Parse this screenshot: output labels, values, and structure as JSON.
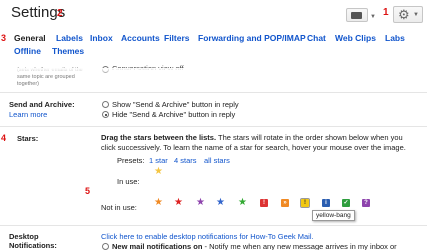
{
  "header": {
    "title": "Settings"
  },
  "annotations": {
    "n1": "1",
    "n2": "2",
    "n3": "3",
    "n4": "4",
    "n5": "5"
  },
  "tabs": [
    "General",
    "Labels",
    "Inbox",
    "Accounts",
    "Filters",
    "Forwarding and POP/IMAP",
    "Chat",
    "Web Clips",
    "Labs",
    "Offline",
    "Themes"
  ],
  "conversation": {
    "hint": "(sets whether emails of the same topic are grouped together)",
    "option_off": "Conversation view off"
  },
  "send_archive": {
    "label": "Send and Archive:",
    "learn_more": "Learn more",
    "option_show": "Show \"Send & Archive\" button in reply",
    "option_hide": "Hide \"Send & Archive\" button in reply"
  },
  "stars": {
    "label": "Stars:",
    "instr_bold": "Drag the stars between the lists.",
    "instr_rest_1": " The stars will rotate in the order shown below when you",
    "instr_line_2": "click successively. To learn the name of a star for search, hover your mouse over the image.",
    "presets_label": "Presets:",
    "preset_1": "1 star",
    "preset_4": "4 stars",
    "preset_all": "all stars",
    "in_use_label": "In use:",
    "not_in_use_label": "Not in use:",
    "tooltip": "yellow-bang",
    "colors": {
      "yellow": "#f4c542",
      "red": "#dd2222",
      "orange": "#f08a24",
      "purple": "#8e44ad",
      "blue": "#3366cc",
      "green": "#33aa33",
      "red_bang": "#dd3333",
      "orange_guillemet": "#f08a24",
      "yellow_bang": "#f2c811",
      "blue_info": "#2a5db0",
      "green_check": "#2e9e3e",
      "purple_question": "#8e44ad"
    }
  },
  "desktop": {
    "label_1": "Desktop",
    "label_2": "Notifications:",
    "enable_link": "Click here to enable desktop notifications for How-To Geek Mail.",
    "option_new_bold": "New mail notifications on",
    "option_new_rest": " - Notify me when any new message arrives in my inbox or"
  }
}
